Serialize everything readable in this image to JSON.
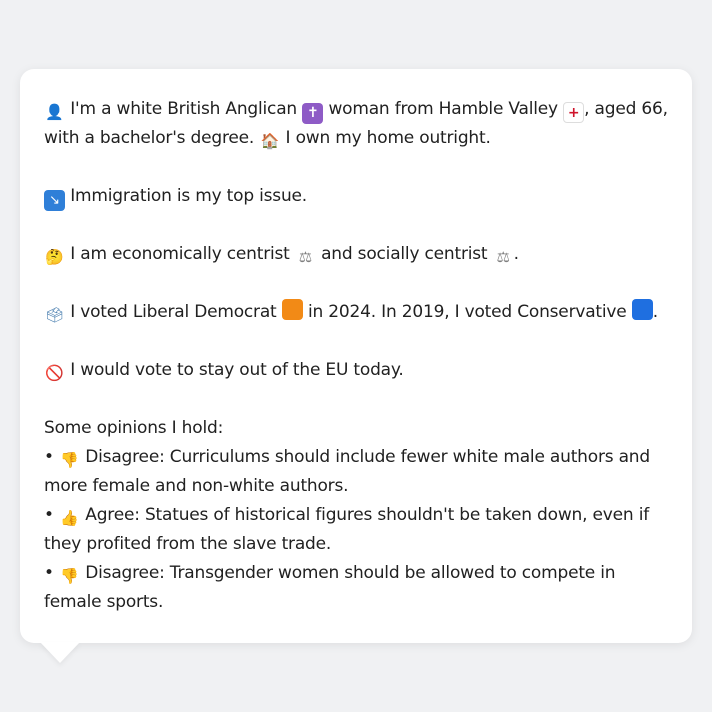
{
  "profile": {
    "line1_a": "I'm a white British Anglican",
    "line1_b": "woman from Hamble Valley",
    "line1_c": ", aged 66, with a bachelor's degree.",
    "line1_d": "I own my home outright.",
    "issue": "Immigration is my top issue.",
    "economics_a": "I am economically centrist",
    "economics_b": "and socially centrist",
    "economics_c": ".",
    "vote_a": "I voted Liberal Democrat",
    "vote_b": "in 2024. In 2019, I voted Conservative",
    "vote_c": ".",
    "eu": "I would vote to stay out of the EU today.",
    "opinions_heading": "Some opinions I hold:",
    "opinions": [
      {
        "bullet": "•",
        "label": "Disagree: Curriculums should include fewer white male authors and more female and non-white authors."
      },
      {
        "bullet": "•",
        "label": "Agree: Statues of historical figures shouldn't be taken down, even if they profited from the slave trade."
      },
      {
        "bullet": "•",
        "label": "Disagree: Transgender women should be allowed to compete in female sports."
      }
    ]
  },
  "icons": {
    "person": "👤",
    "cross": "✝",
    "flag": "+",
    "house": "🏠",
    "arrow": "↘",
    "think": "🤔",
    "scales": "⚖",
    "ballot": "🗳",
    "no": "🚫",
    "thumbs_down": "👎",
    "thumbs_up": "👍"
  },
  "colors": {
    "background": "#f0f1f3",
    "card": "#ffffff",
    "text": "#212121",
    "libdem": "#f28a16",
    "conservative": "#1f6fe0"
  }
}
